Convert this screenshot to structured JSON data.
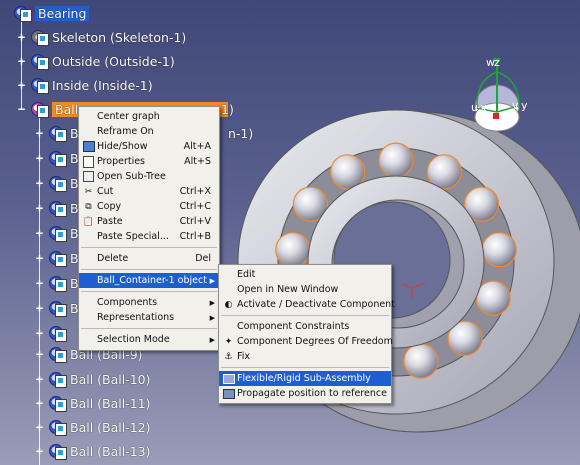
{
  "tree": {
    "root": "Bearing",
    "items": [
      {
        "label": "Skeleton (Skeleton-1)",
        "expander": "+"
      },
      {
        "label": "Outside (Outside-1)",
        "expander": "+"
      },
      {
        "label": "Inside (Inside-1)",
        "expander": "+"
      },
      {
        "label": "Ball",
        "expander": "−",
        "suffix": "1)"
      },
      {
        "label": "",
        "suffix": "n-1)"
      },
      {
        "label": "Ball (Ball-9)"
      },
      {
        "label": "Ball (Ball-10)"
      },
      {
        "label": "Ball (Ball-11)"
      },
      {
        "label": "Ball (Ball-12)"
      },
      {
        "label": "Ball (Ball-13)"
      }
    ],
    "partial_children": [
      "B",
      "B",
      "B",
      "B",
      "B",
      "B",
      "B",
      "B"
    ]
  },
  "context_menu": {
    "items": [
      {
        "label": "Center graph",
        "shortcut": ""
      },
      {
        "label": "Reframe On",
        "shortcut": ""
      },
      {
        "label": "Hide/Show",
        "shortcut": "Alt+A"
      },
      {
        "label": "Properties",
        "shortcut": "Alt+S"
      },
      {
        "label": "Open Sub-Tree",
        "shortcut": ""
      },
      {
        "label": "Cut",
        "shortcut": "Ctrl+X"
      },
      {
        "label": "Copy",
        "shortcut": "Ctrl+C"
      },
      {
        "label": "Paste",
        "shortcut": "Ctrl+V"
      },
      {
        "label": "Paste Special...",
        "shortcut": "Ctrl+B"
      },
      {
        "label": "Delete",
        "shortcut": "Del"
      },
      {
        "label": "Ball_Container-1 object",
        "shortcut": ""
      },
      {
        "label": "Components",
        "shortcut": ""
      },
      {
        "label": "Representations",
        "shortcut": ""
      },
      {
        "label": "Selection Mode",
        "shortcut": ""
      }
    ]
  },
  "submenu": {
    "items": [
      {
        "label": "Edit"
      },
      {
        "label": "Open in New Window"
      },
      {
        "label": "Activate / Deactivate Component"
      },
      {
        "label": "Component Constraints"
      },
      {
        "label": "Component Degrees Of Freedom"
      },
      {
        "label": "Fix"
      },
      {
        "label": "Flexible/Rigid Sub-Assembly"
      },
      {
        "label": "Propagate position to reference"
      }
    ]
  },
  "compass": {
    "u": "u",
    "v": "v",
    "w": "w",
    "x": "x",
    "y": "y",
    "z": "z"
  },
  "colors": {
    "selection": "#2060c8",
    "highlight_orange": "#f18a1c",
    "menu_bg": "#f1f0ea",
    "menu_highlight": "#1d5fd1"
  }
}
